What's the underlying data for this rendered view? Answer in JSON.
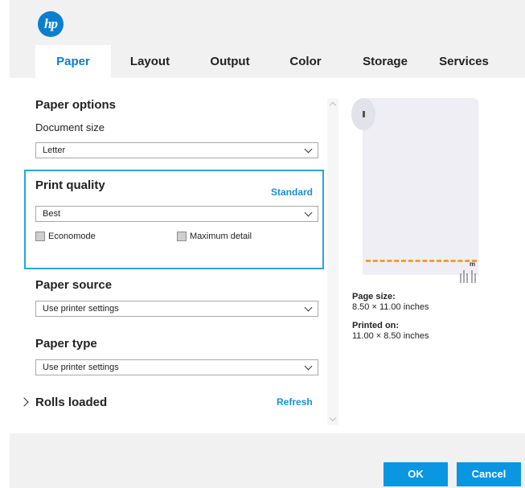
{
  "logo": {
    "text": "hp"
  },
  "tabs": [
    {
      "label": "Paper",
      "active": true
    },
    {
      "label": "Layout"
    },
    {
      "label": "Output"
    },
    {
      "label": "Color"
    },
    {
      "label": "Storage"
    },
    {
      "label": "Services"
    }
  ],
  "paper_options": {
    "title": "Paper options",
    "document_size_label": "Document size",
    "document_size_value": "Letter"
  },
  "print_quality": {
    "title": "Print quality",
    "preset_link": "Standard",
    "quality_value": "Best",
    "economode_label": "Economode",
    "economode_checked": false,
    "max_detail_label": "Maximum detail",
    "max_detail_checked": false
  },
  "paper_source": {
    "title": "Paper source",
    "value": "Use printer settings"
  },
  "paper_type": {
    "title": "Paper type",
    "value": "Use printer settings"
  },
  "rolls_loaded": {
    "title": "Rolls loaded",
    "refresh_label": "Refresh"
  },
  "preview": {
    "page_size_label": "Page size:",
    "page_size_value": "8.50 × 11.00 inches",
    "printed_on_label": "Printed on:",
    "printed_on_value": "11.00 × 8.50 inches",
    "ruler_label": "m",
    "accent_color": "#f0a030"
  },
  "footer": {
    "ok_label": "OK",
    "cancel_label": "Cancel"
  },
  "colors": {
    "accent": "#0a96e0",
    "highlight_border": "#2aa3e0"
  }
}
